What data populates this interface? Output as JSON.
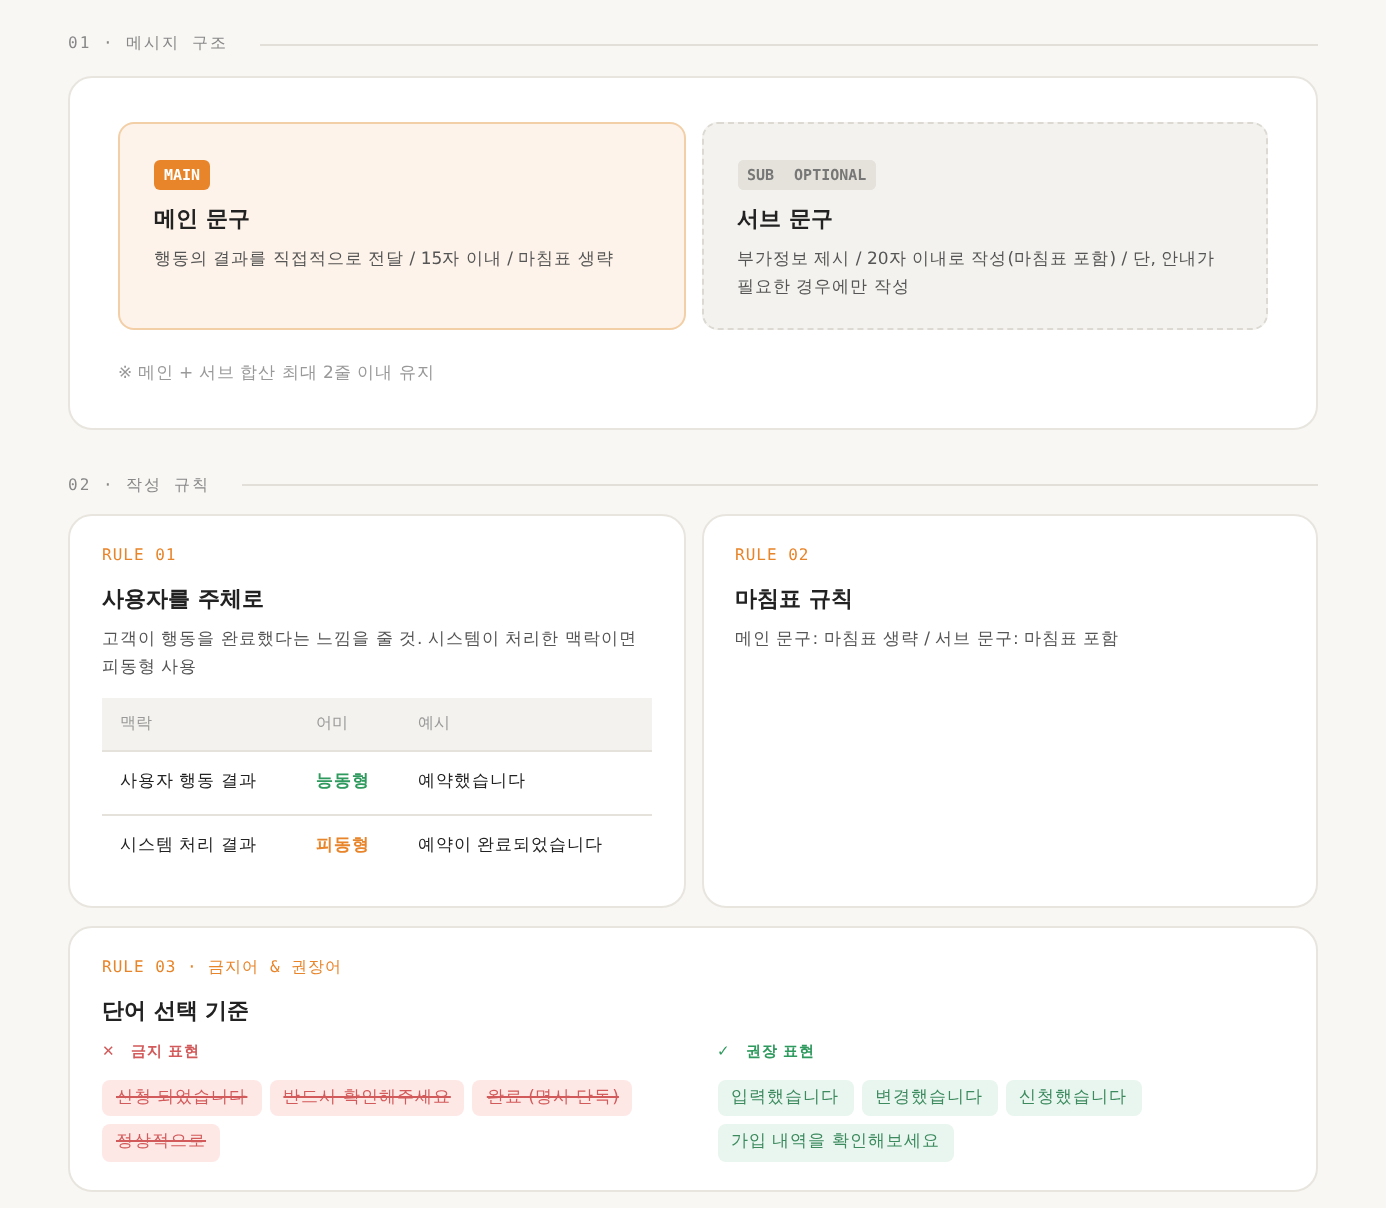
{
  "sections": [
    {
      "label": "01 · 메시지 구조"
    },
    {
      "label": "02 · 작성 규칙"
    }
  ],
  "structure": {
    "blocks": [
      {
        "kind": "main",
        "tags": [
          "MAIN"
        ],
        "title": "메인 문구",
        "desc": "행동의 결과를 직접적으로 전달 / 15자 이내 / 마침표 생략"
      },
      {
        "kind": "sub",
        "tags": [
          "SUB",
          "OPTIONAL"
        ],
        "title": "서브 문구",
        "desc": "부가정보 제시 / 20자 이내로 작성(마침표 포함) / 단, 안내가 필요한 경우에만 작성"
      }
    ],
    "note": "※ 메인 + 서브 합산 최대 2줄 이내 유지"
  },
  "rules": [
    {
      "label": "RULE 01",
      "title": "사용자를 주체로",
      "desc": "고객이 행동을 완료했다는 느낌을 줄 것. 시스템이 처리한 맥락이면 피동형 사용",
      "table": {
        "columns": [
          "맥락",
          "어미",
          "예시"
        ],
        "rows": [
          {
            "context": "사용자 행동 결과",
            "ending": "능동형",
            "kind": "active",
            "example": "예약했습니다"
          },
          {
            "context": "시스템 처리 결과",
            "ending": "피동형",
            "kind": "passive",
            "example": "예약이 완료되었습니다"
          }
        ]
      }
    },
    {
      "label": "RULE 02",
      "title": "마침표 규칙",
      "desc": "메인 문구: 마침표 생략 / 서브 문구: 마침표 포함"
    }
  ],
  "words": {
    "label": "RULE 03 · 금지어 & 권장어",
    "title": "단어 선택 기준",
    "groups": [
      {
        "kind": "banned",
        "mark": "✕",
        "label": "금지 표현",
        "items": [
          "신청 되었습니다",
          "반드시 확인해주세요",
          "완료 (명사 단독)",
          "정상적으로"
        ]
      },
      {
        "kind": "recommended",
        "mark": "✓",
        "label": "권장 표현",
        "items": [
          "입력했습니다",
          "변경했습니다",
          "신청했습니다",
          "가입 내역을 확인해보세요"
        ]
      }
    ]
  }
}
